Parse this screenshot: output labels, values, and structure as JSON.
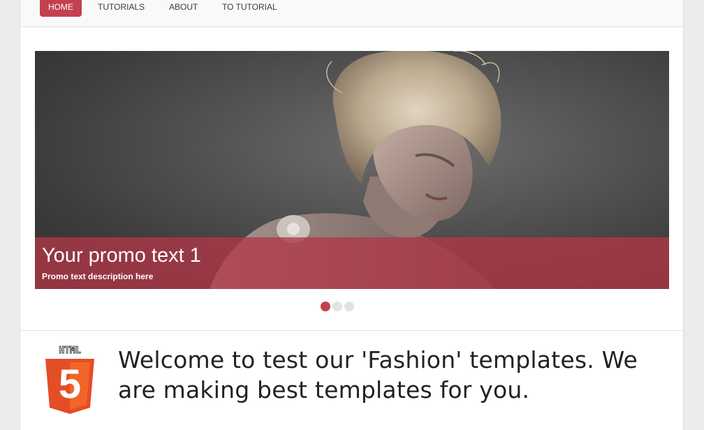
{
  "nav": {
    "items": [
      {
        "label": "HOME",
        "active": true
      },
      {
        "label": "TUTORIALS",
        "active": false
      },
      {
        "label": "ABOUT",
        "active": false
      },
      {
        "label": "TO TUTORIAL",
        "active": false
      }
    ]
  },
  "slider": {
    "caption_title": "Your promo text 1",
    "caption_description": "Promo text description here",
    "slide_count": 3,
    "active_slide": 1
  },
  "logo": {
    "label": "HTML",
    "glyph": "5"
  },
  "welcome": {
    "text": "Welcome to test our 'Fashion' templates. We are making best templates for you."
  },
  "colors": {
    "accent": "#c3404f",
    "caption_overlay": "#b03848",
    "logo_orange": "#e44d26"
  }
}
